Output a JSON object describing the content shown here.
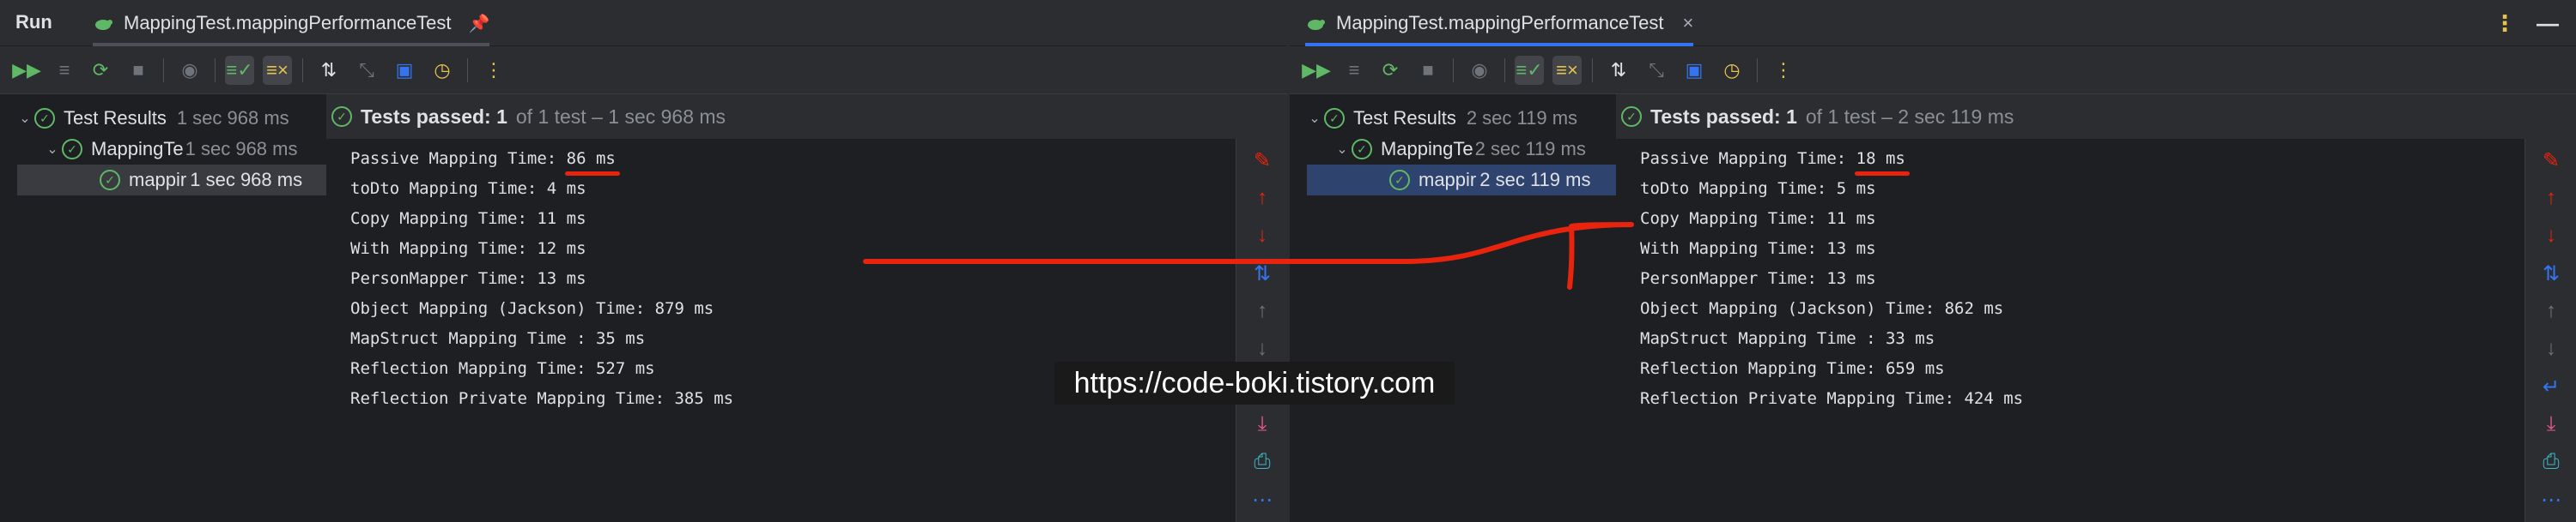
{
  "left": {
    "run_label": "Run",
    "tab_title": "MappingTest.mappingPerformanceTest",
    "tree": [
      {
        "name": "Test Results",
        "time": "1 sec 968 ms"
      },
      {
        "name": "MappingTe",
        "time": "1 sec 968 ms"
      },
      {
        "name": "mappir",
        "time": "1 sec 968 ms"
      }
    ],
    "status": {
      "passed": "Tests passed: 1",
      "detail": "of 1 test – 1 sec 968 ms"
    },
    "console": [
      "Passive Mapping Time: 86 ms",
      "toDto Mapping Time: 4 ms",
      "Copy Mapping Time: 11 ms",
      "With Mapping Time: 12 ms",
      "PersonMapper Time: 13 ms",
      "Object Mapping (Jackson) Time: 879 ms",
      "MapStruct Mapping Time : 35 ms",
      "Reflection Mapping Time: 527 ms",
      "Reflection Private Mapping Time: 385 ms"
    ]
  },
  "right": {
    "tab_title": "MappingTest.mappingPerformanceTest",
    "tree": [
      {
        "name": "Test Results",
        "time": "2 sec 119 ms"
      },
      {
        "name": "MappingTe",
        "time": "2 sec 119 ms"
      },
      {
        "name": "mappir",
        "time": "2 sec 119 ms"
      }
    ],
    "status": {
      "passed": "Tests passed: 1",
      "detail": "of 1 test – 2 sec 119 ms"
    },
    "console": [
      "Passive Mapping Time: 18 ms",
      "toDto Mapping Time: 5 ms",
      "Copy Mapping Time: 11 ms",
      "With Mapping Time: 13 ms",
      "PersonMapper Time: 13 ms",
      "Object Mapping (Jackson) Time: 862 ms",
      "MapStruct Mapping Time : 33 ms",
      "Reflection Mapping Time: 659 ms",
      "Reflection Private Mapping Time: 424 ms"
    ]
  },
  "watermark": "https://code-boki.tistory.com",
  "icons": {
    "toolbar": [
      "rerun-all-icon",
      "rerun-failed-icon",
      "rerun-icon",
      "stop-icon",
      "eye-icon",
      "show-passed-icon",
      "show-ignored-icon",
      "sort-icon",
      "collapse-icon",
      "export-icon",
      "history-icon",
      "more-icon"
    ],
    "gutter": [
      "clear-icon",
      "up-arrow-icon",
      "down-arrow-icon",
      "sort-lines-icon",
      "scroll-up-icon",
      "scroll-down-icon",
      "soft-wrap-icon",
      "scroll-to-end-icon",
      "print-icon",
      "more-icon"
    ]
  },
  "colors": {
    "accent_blue": "#3574f0",
    "pass_green": "#5fb865",
    "annotation_red": "#e8230e",
    "toolbar_orange": "#e8c34c",
    "rerun_green": "#5fb865"
  }
}
